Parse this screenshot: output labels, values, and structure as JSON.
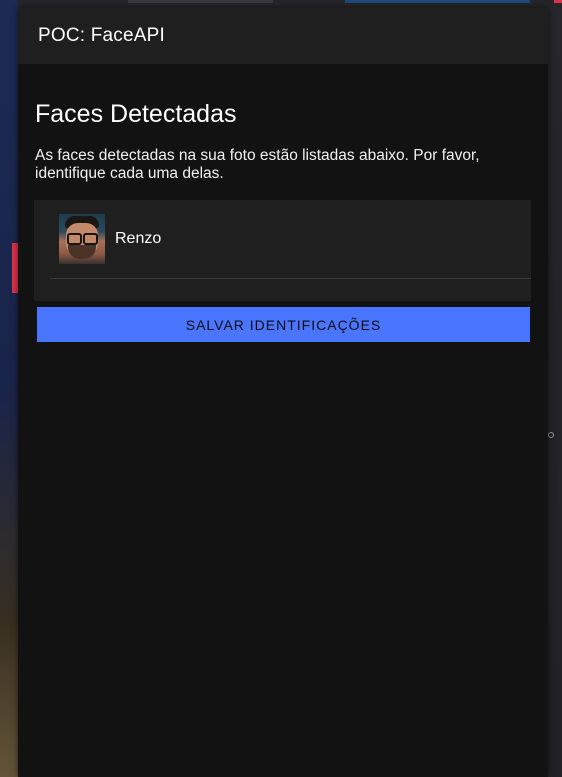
{
  "header": {
    "title": "POC: FaceAPI"
  },
  "main": {
    "heading": "Faces Detectadas",
    "description": "As faces detectadas na sua foto estão listadas abaixo. Por favor, identifique cada uma delas.",
    "faces": [
      {
        "name": "Renzo",
        "avatar_icon": "person-photo"
      }
    ],
    "save_label": "SALVAR IDENTIFICAÇÕES"
  },
  "colors": {
    "accent": "#4a76ff",
    "panel": "#121213",
    "header": "#1f1f20"
  }
}
